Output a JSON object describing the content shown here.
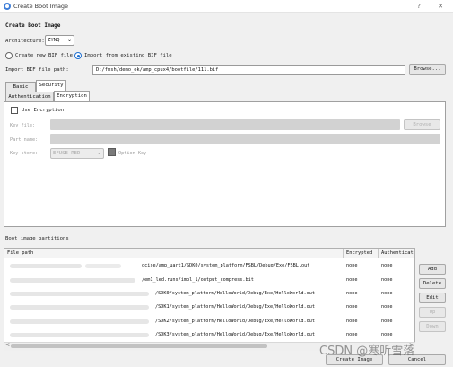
{
  "window": {
    "title": "Create Boot Image",
    "help_glyph": "?",
    "close_glyph": "✕"
  },
  "heading": "Create Boot Image",
  "architecture": {
    "label": "Architecture:",
    "value": "ZYNQ",
    "arrow": "⌄"
  },
  "bif_mode": {
    "create_new_label": "Create new BIF file",
    "import_label": "Import from existing BIF file",
    "selected": "import"
  },
  "import_bif": {
    "label": "Import BIF file path:",
    "value": "D:/fmsh/demo_ok/amp_cpux4/bootfile/111.bif",
    "browse_label": "Browse..."
  },
  "outer_tabs": [
    {
      "label": "Basic",
      "active": false
    },
    {
      "label": "Security",
      "active": true
    }
  ],
  "inner_tabs": [
    {
      "label": "Authentication",
      "active": false
    },
    {
      "label": "Encryption",
      "active": true
    }
  ],
  "encryption": {
    "use_encryption_label": "Use Encryption",
    "use_encryption_checked": false,
    "key_file_label": "Key file:",
    "key_file_browse": "Browse",
    "part_name_label": "Part name:",
    "key_store_label": "Key store:",
    "key_store_value": "EFUSE RED",
    "key_store_arrow": "⌄",
    "option_key_label": "Option Key"
  },
  "partitions": {
    "section_label": "Boot image partitions",
    "columns": [
      "File path",
      "Encrypted",
      "Authenticat"
    ],
    "rows": [
      {
        "path": "ocise/amp_uart1/SDK0/system_platform/FSBL/Debug/Exe/FSBL.out",
        "encrypted": "none",
        "auth": "none"
      },
      {
        "path": "/em1_led.runs/impl_1/output_compress.bit",
        "encrypted": "none",
        "auth": "none"
      },
      {
        "path": "/SDK0/system_platform/HelloWorld/Debug/Exe/HelloWorld.out",
        "encrypted": "none",
        "auth": "none"
      },
      {
        "path": "/SDK1/system_platform/HelloWorld/Debug/Exe/HelloWorld.out",
        "encrypted": "none",
        "auth": "none"
      },
      {
        "path": "/SDK2/system_platform/HelloWorld/Debug/Exe/HelloWorld.out",
        "encrypted": "none",
        "auth": "none"
      },
      {
        "path": "/SDK3/system_platform/HelloWorld/Debug/Exe/HelloWorld.out",
        "encrypted": "none",
        "auth": "none"
      }
    ],
    "scroll_left": "<",
    "scroll_right": ">"
  },
  "side_buttons": {
    "add": "Add",
    "delete": "Delete",
    "edit": "Edit",
    "up": "Up",
    "down": "Down"
  },
  "footer": {
    "create_label": "Create Image",
    "cancel_label": "Cancel"
  },
  "watermark": "CSDN @寒听雪落",
  "colors": {
    "accent": "#1e6fd0",
    "window_bg": "#f0f0f0",
    "disabled_field": "#d2d2d2"
  },
  "icons": {
    "app": "boot-image-app-icon",
    "option_key": "color-swatch-icon"
  }
}
